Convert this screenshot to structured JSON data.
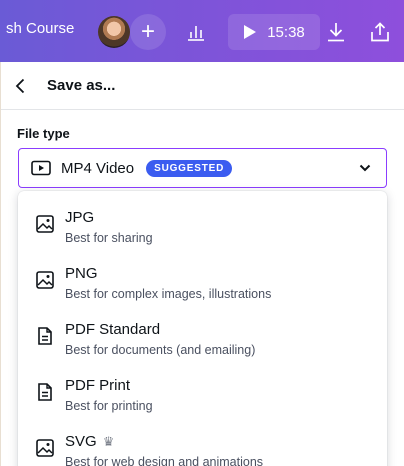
{
  "topbar": {
    "design_title": "sh Course",
    "add_collaborator_label": "+",
    "present_timer": "15:38"
  },
  "panel": {
    "title": "Save as...",
    "file_type_label": "File type",
    "selected": {
      "label": "MP4 Video",
      "badge": "SUGGESTED"
    },
    "options": [
      {
        "name": "JPG",
        "desc": "Best for sharing",
        "icon": "image-icon"
      },
      {
        "name": "PNG",
        "desc": "Best for complex images, illustrations",
        "icon": "image-icon"
      },
      {
        "name": "PDF Standard",
        "desc": "Best for documents (and emailing)",
        "icon": "document-icon"
      },
      {
        "name": "PDF Print",
        "desc": "Best for printing",
        "icon": "document-icon"
      },
      {
        "name": "SVG",
        "desc": "Best for web design and animations",
        "icon": "image-icon",
        "premium": true
      }
    ]
  },
  "colors": {
    "toolbar_start": "#6a5bd6",
    "toolbar_end": "#8e4fdc",
    "select_border": "#8b3dff",
    "badge_bg": "#3b5cf0",
    "page_bg": "#fdf3e3"
  }
}
